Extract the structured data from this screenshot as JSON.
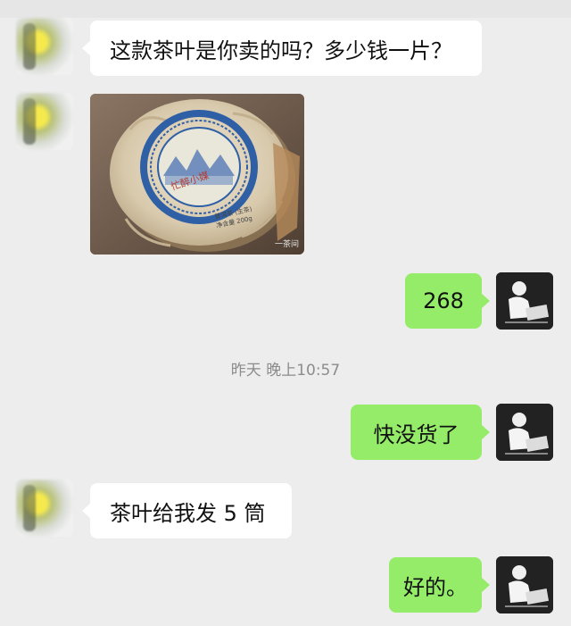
{
  "colors": {
    "background": "#ededed",
    "incoming_bubble": "#ffffff",
    "outgoing_bubble": "#95ec69",
    "timestamp_text": "#8c8c8c"
  },
  "messages": [
    {
      "side": "in",
      "text": "这款茶叶是你卖的吗？多少钱一片？"
    },
    {
      "side": "in",
      "type": "image",
      "image_label": "普洱茶饼 (包装纸)",
      "image_icon": "tea-cake-photo"
    },
    {
      "side": "out",
      "text": "268"
    },
    {
      "side": "out",
      "text": "快没货了"
    },
    {
      "side": "in",
      "text": "茶叶给我发 5 筒"
    },
    {
      "side": "out",
      "text": "好的。"
    }
  ],
  "timestamp": "昨天 晚上10:57",
  "photo": {
    "seal_text": "忙醉小媒",
    "label_lines": [
      "普洱茶 (生茶)",
      "净含量 200g"
    ],
    "watermark": "一茶间"
  }
}
